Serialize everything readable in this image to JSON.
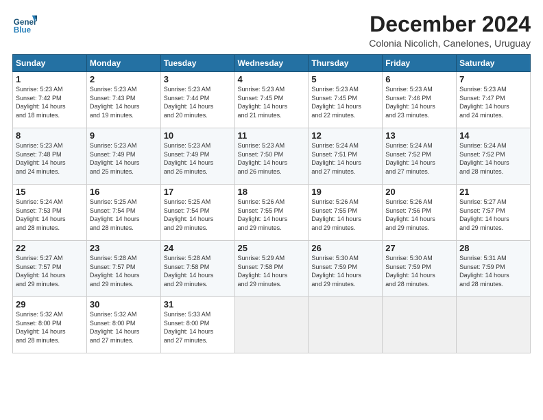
{
  "logo": {
    "line1": "General",
    "line2": "Blue"
  },
  "title": "December 2024",
  "subtitle": "Colonia Nicolich, Canelones, Uruguay",
  "weekdays": [
    "Sunday",
    "Monday",
    "Tuesday",
    "Wednesday",
    "Thursday",
    "Friday",
    "Saturday"
  ],
  "weeks": [
    [
      {
        "day": "1",
        "info": "Sunrise: 5:23 AM\nSunset: 7:42 PM\nDaylight: 14 hours\nand 18 minutes."
      },
      {
        "day": "2",
        "info": "Sunrise: 5:23 AM\nSunset: 7:43 PM\nDaylight: 14 hours\nand 19 minutes."
      },
      {
        "day": "3",
        "info": "Sunrise: 5:23 AM\nSunset: 7:44 PM\nDaylight: 14 hours\nand 20 minutes."
      },
      {
        "day": "4",
        "info": "Sunrise: 5:23 AM\nSunset: 7:45 PM\nDaylight: 14 hours\nand 21 minutes."
      },
      {
        "day": "5",
        "info": "Sunrise: 5:23 AM\nSunset: 7:45 PM\nDaylight: 14 hours\nand 22 minutes."
      },
      {
        "day": "6",
        "info": "Sunrise: 5:23 AM\nSunset: 7:46 PM\nDaylight: 14 hours\nand 23 minutes."
      },
      {
        "day": "7",
        "info": "Sunrise: 5:23 AM\nSunset: 7:47 PM\nDaylight: 14 hours\nand 24 minutes."
      }
    ],
    [
      {
        "day": "8",
        "info": "Sunrise: 5:23 AM\nSunset: 7:48 PM\nDaylight: 14 hours\nand 24 minutes."
      },
      {
        "day": "9",
        "info": "Sunrise: 5:23 AM\nSunset: 7:49 PM\nDaylight: 14 hours\nand 25 minutes."
      },
      {
        "day": "10",
        "info": "Sunrise: 5:23 AM\nSunset: 7:49 PM\nDaylight: 14 hours\nand 26 minutes."
      },
      {
        "day": "11",
        "info": "Sunrise: 5:23 AM\nSunset: 7:50 PM\nDaylight: 14 hours\nand 26 minutes."
      },
      {
        "day": "12",
        "info": "Sunrise: 5:24 AM\nSunset: 7:51 PM\nDaylight: 14 hours\nand 27 minutes."
      },
      {
        "day": "13",
        "info": "Sunrise: 5:24 AM\nSunset: 7:52 PM\nDaylight: 14 hours\nand 27 minutes."
      },
      {
        "day": "14",
        "info": "Sunrise: 5:24 AM\nSunset: 7:52 PM\nDaylight: 14 hours\nand 28 minutes."
      }
    ],
    [
      {
        "day": "15",
        "info": "Sunrise: 5:24 AM\nSunset: 7:53 PM\nDaylight: 14 hours\nand 28 minutes."
      },
      {
        "day": "16",
        "info": "Sunrise: 5:25 AM\nSunset: 7:54 PM\nDaylight: 14 hours\nand 28 minutes."
      },
      {
        "day": "17",
        "info": "Sunrise: 5:25 AM\nSunset: 7:54 PM\nDaylight: 14 hours\nand 29 minutes."
      },
      {
        "day": "18",
        "info": "Sunrise: 5:26 AM\nSunset: 7:55 PM\nDaylight: 14 hours\nand 29 minutes."
      },
      {
        "day": "19",
        "info": "Sunrise: 5:26 AM\nSunset: 7:55 PM\nDaylight: 14 hours\nand 29 minutes."
      },
      {
        "day": "20",
        "info": "Sunrise: 5:26 AM\nSunset: 7:56 PM\nDaylight: 14 hours\nand 29 minutes."
      },
      {
        "day": "21",
        "info": "Sunrise: 5:27 AM\nSunset: 7:57 PM\nDaylight: 14 hours\nand 29 minutes."
      }
    ],
    [
      {
        "day": "22",
        "info": "Sunrise: 5:27 AM\nSunset: 7:57 PM\nDaylight: 14 hours\nand 29 minutes."
      },
      {
        "day": "23",
        "info": "Sunrise: 5:28 AM\nSunset: 7:57 PM\nDaylight: 14 hours\nand 29 minutes."
      },
      {
        "day": "24",
        "info": "Sunrise: 5:28 AM\nSunset: 7:58 PM\nDaylight: 14 hours\nand 29 minutes."
      },
      {
        "day": "25",
        "info": "Sunrise: 5:29 AM\nSunset: 7:58 PM\nDaylight: 14 hours\nand 29 minutes."
      },
      {
        "day": "26",
        "info": "Sunrise: 5:30 AM\nSunset: 7:59 PM\nDaylight: 14 hours\nand 29 minutes."
      },
      {
        "day": "27",
        "info": "Sunrise: 5:30 AM\nSunset: 7:59 PM\nDaylight: 14 hours\nand 28 minutes."
      },
      {
        "day": "28",
        "info": "Sunrise: 5:31 AM\nSunset: 7:59 PM\nDaylight: 14 hours\nand 28 minutes."
      }
    ],
    [
      {
        "day": "29",
        "info": "Sunrise: 5:32 AM\nSunset: 8:00 PM\nDaylight: 14 hours\nand 28 minutes."
      },
      {
        "day": "30",
        "info": "Sunrise: 5:32 AM\nSunset: 8:00 PM\nDaylight: 14 hours\nand 27 minutes."
      },
      {
        "day": "31",
        "info": "Sunrise: 5:33 AM\nSunset: 8:00 PM\nDaylight: 14 hours\nand 27 minutes."
      },
      null,
      null,
      null,
      null
    ]
  ]
}
